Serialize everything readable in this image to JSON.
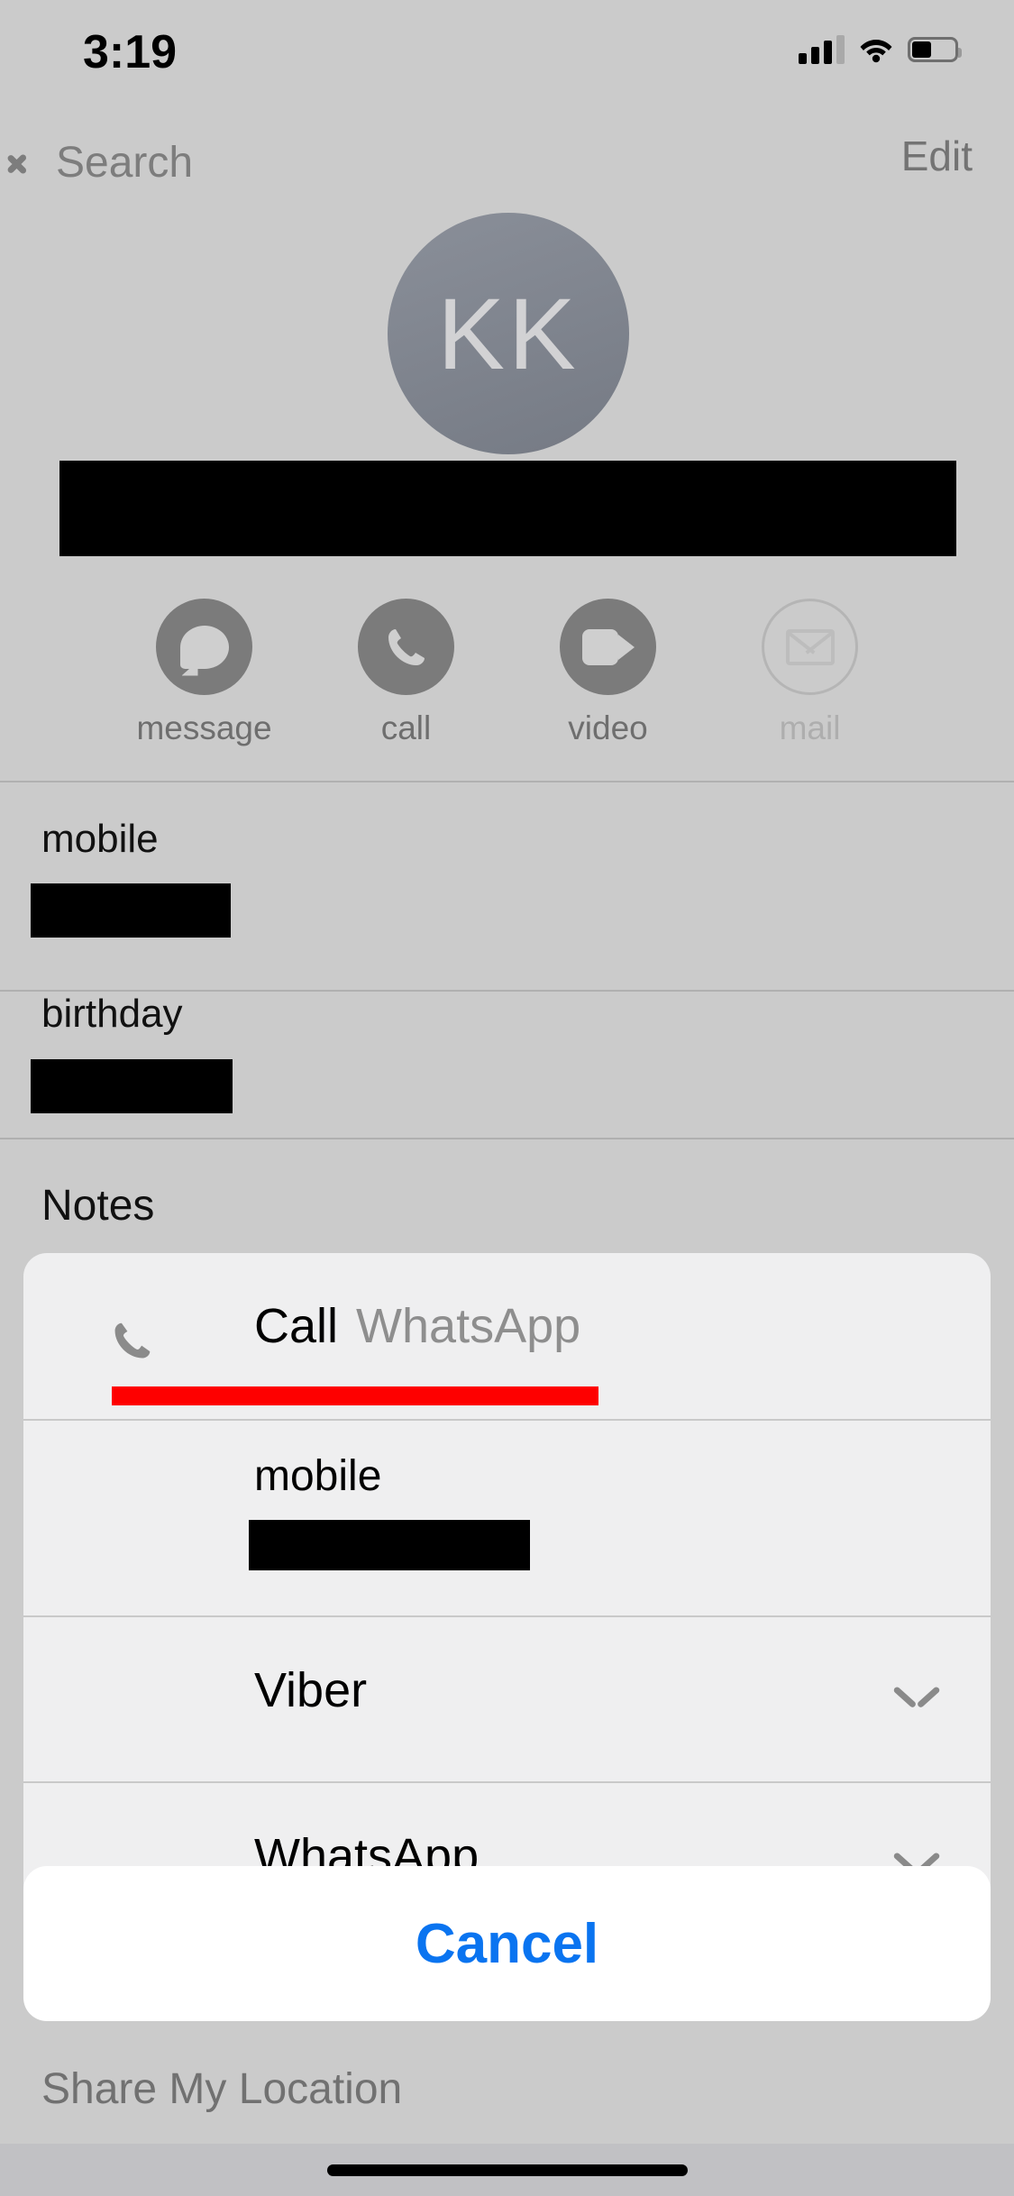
{
  "status_bar": {
    "time": "3:19",
    "signal_icon": "cellular-signal-icon",
    "signal_bars_filled": 3,
    "signal_bars_total": 4,
    "wifi_icon": "wifi-icon",
    "battery_icon": "battery-icon",
    "battery_level_percent": 40
  },
  "nav_bar": {
    "back_label": "Search",
    "back_icon": "chevron-left-icon",
    "edit_label": "Edit"
  },
  "contact": {
    "avatar_initials": "KK",
    "avatar_color": "#7e838d",
    "name_redacted": true
  },
  "quick_actions": [
    {
      "label": "message",
      "icon": "message-bubble-icon",
      "disabled": false
    },
    {
      "label": "call",
      "icon": "phone-icon",
      "disabled": false
    },
    {
      "label": "video",
      "icon": "video-camera-icon",
      "disabled": false
    },
    {
      "label": "mail",
      "icon": "envelope-icon",
      "disabled": true
    }
  ],
  "fields": [
    {
      "label": "mobile",
      "value_redacted": true
    },
    {
      "label": "birthday",
      "value_redacted": true
    },
    {
      "label": "Notes",
      "value_redacted": false
    }
  ],
  "background_items": [
    {
      "label": "Share My Location"
    }
  ],
  "action_sheet": {
    "header": {
      "icon": "phone-icon",
      "title": "Call",
      "subtitle": "WhatsApp",
      "annotation_color": "#fe0000"
    },
    "rows": [
      {
        "type": "number",
        "label": "mobile",
        "value_redacted": true
      },
      {
        "type": "app",
        "label": "Viber",
        "chevron_icon": "chevron-down-icon"
      },
      {
        "type": "app",
        "label": "WhatsApp",
        "chevron_icon": "chevron-down-icon"
      }
    ],
    "cancel_label": "Cancel",
    "cancel_color": "#0a74f0"
  },
  "home_indicator": "home-indicator"
}
